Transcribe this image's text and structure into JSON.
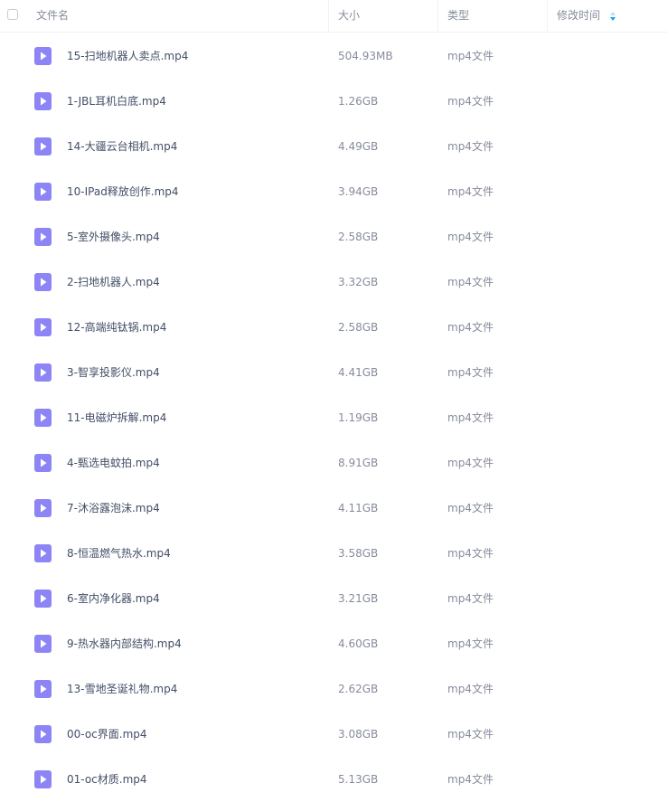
{
  "header": {
    "name": "文件名",
    "size": "大小",
    "type": "类型",
    "modified": "修改时间"
  },
  "icons": {
    "file": "video-file-icon",
    "file_color": "#8d85f5",
    "sort": "sort-arrows-icon",
    "sort_color": "#06a7ff"
  },
  "files": [
    {
      "name": "15-扫地机器人卖点.mp4",
      "size": "504.93MB",
      "type": "mp4文件"
    },
    {
      "name": "1-JBL耳机白底.mp4",
      "size": "1.26GB",
      "type": "mp4文件"
    },
    {
      "name": "14-大疆云台相机.mp4",
      "size": "4.49GB",
      "type": "mp4文件"
    },
    {
      "name": "10-IPad释放创作.mp4",
      "size": "3.94GB",
      "type": "mp4文件"
    },
    {
      "name": "5-室外摄像头.mp4",
      "size": "2.58GB",
      "type": "mp4文件"
    },
    {
      "name": "2-扫地机器人.mp4",
      "size": "3.32GB",
      "type": "mp4文件"
    },
    {
      "name": "12-高端纯钛锅.mp4",
      "size": "2.58GB",
      "type": "mp4文件"
    },
    {
      "name": "3-智享投影仪.mp4",
      "size": "4.41GB",
      "type": "mp4文件"
    },
    {
      "name": "11-电磁炉拆解.mp4",
      "size": "1.19GB",
      "type": "mp4文件"
    },
    {
      "name": "4-甄选电蚊拍.mp4",
      "size": "8.91GB",
      "type": "mp4文件"
    },
    {
      "name": "7-沐浴露泡沫.mp4",
      "size": "4.11GB",
      "type": "mp4文件"
    },
    {
      "name": "8-恒温燃气热水.mp4",
      "size": "3.58GB",
      "type": "mp4文件"
    },
    {
      "name": "6-室内净化器.mp4",
      "size": "3.21GB",
      "type": "mp4文件"
    },
    {
      "name": "9-热水器内部结构.mp4",
      "size": "4.60GB",
      "type": "mp4文件"
    },
    {
      "name": "13-雪地圣诞礼物.mp4",
      "size": "2.62GB",
      "type": "mp4文件"
    },
    {
      "name": "00-oc界面.mp4",
      "size": "3.08GB",
      "type": "mp4文件"
    },
    {
      "name": "01-oc材质.mp4",
      "size": "5.13GB",
      "type": "mp4文件"
    }
  ]
}
